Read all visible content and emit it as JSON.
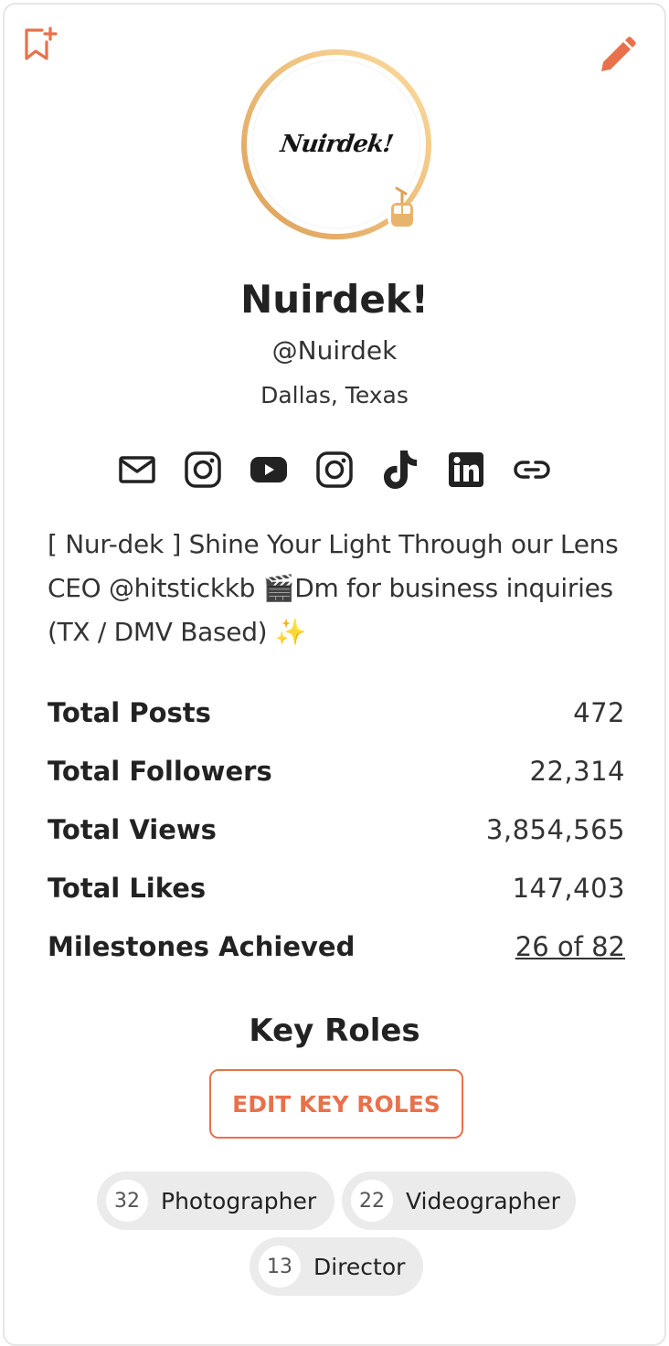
{
  "profile": {
    "display_name": "Nuirdek!",
    "handle": "@Nuirdek",
    "location": "Dallas, Texas",
    "avatar_logo_text": "Nuirdek!",
    "bio": "[ Nur-dek ] Shine Your Light Through our Lens CEO @hitstickkb 🎬Dm for business inquiries (TX / DMV Based) ✨"
  },
  "icons": {
    "bookmark": "bookmark-add-icon",
    "edit": "pencil-icon",
    "badge": "cable-car-icon",
    "socials": [
      "mail-icon",
      "instagram-icon",
      "youtube-icon",
      "instagram-icon",
      "tiktok-icon",
      "linkedin-icon",
      "link-icon"
    ]
  },
  "stats": {
    "posts_label": "Total Posts",
    "posts_value": "472",
    "followers_label": "Total Followers",
    "followers_value": "22,314",
    "views_label": "Total Views",
    "views_value": "3,854,565",
    "likes_label": "Total Likes",
    "likes_value": "147,403",
    "milestones_label": "Milestones Achieved",
    "milestones_value": "26 of 82"
  },
  "roles": {
    "title": "Key Roles",
    "edit_label": "EDIT KEY ROLES",
    "items": [
      {
        "count": "32",
        "label": "Photographer"
      },
      {
        "count": "22",
        "label": "Videographer"
      },
      {
        "count": "13",
        "label": "Director"
      }
    ]
  },
  "colors": {
    "accent": "#e8714c",
    "ring_start": "#e0a45e",
    "ring_end": "#fbd99a",
    "chip_bg": "#ebebeb"
  }
}
